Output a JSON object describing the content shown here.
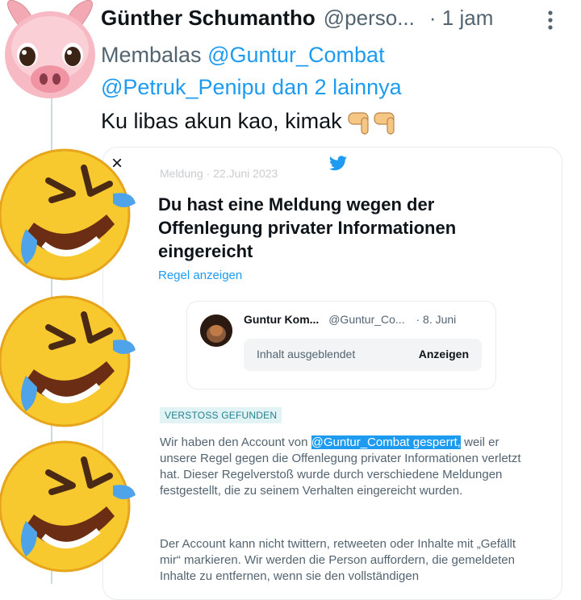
{
  "tweet": {
    "author_name": "Günther Schumantho",
    "author_handle": "@perso...",
    "time": "· 1 jam",
    "reply_prefix": "Membalas",
    "reply_to_1": "@Guntur_Combat",
    "reply_to_2": "@Petruk_Penipu",
    "reply_suffix": "dan 2 lainnya",
    "text": "Ku libas akun kao, kimak",
    "icons": [
      "pig-avatar",
      "more-vertical-icon",
      "pointing-down-emoji",
      "laughing-tears-emoji"
    ]
  },
  "card": {
    "close": "×",
    "meta": "Meldung · 22.Juni 2023",
    "title": "Du hast eine Meldung wegen der Offenlegung privater Informationen eingereicht",
    "rule_link": "Regel anzeigen",
    "quoted": {
      "name": "Guntur Kom...",
      "handle": "@Guntur_Co...",
      "date": "· 8. Juni",
      "hidden_label": "Inhalt ausgeblendet",
      "show_button": "Anzeigen"
    },
    "badge": "VERSTOSS GEFUNDEN",
    "para1_a": "Wir haben den Account von ",
    "para1_highlight": "@Guntur_Combat gesperrt,",
    "para1_b": " weil er unsere Regel gegen die Offenlegung privater Informationen verletzt hat. Dieser Regelverstoß wurde durch verschiedene Meldungen festgestellt, die zu seinem Verhalten eingereicht wurden.",
    "para2": "Der Account kann nicht twittern, retweeten oder Inhalte mit „Gefällt mir“ markieren. Wir werden die Person auffordern, die gemeldeten Inhalte zu entfernen, wenn sie den vollständigen"
  },
  "colors": {
    "link": "#1d9bf0",
    "secondary_text": "#536471",
    "badge_bg": "#e1f3f5",
    "badge_text": "#25808f"
  }
}
